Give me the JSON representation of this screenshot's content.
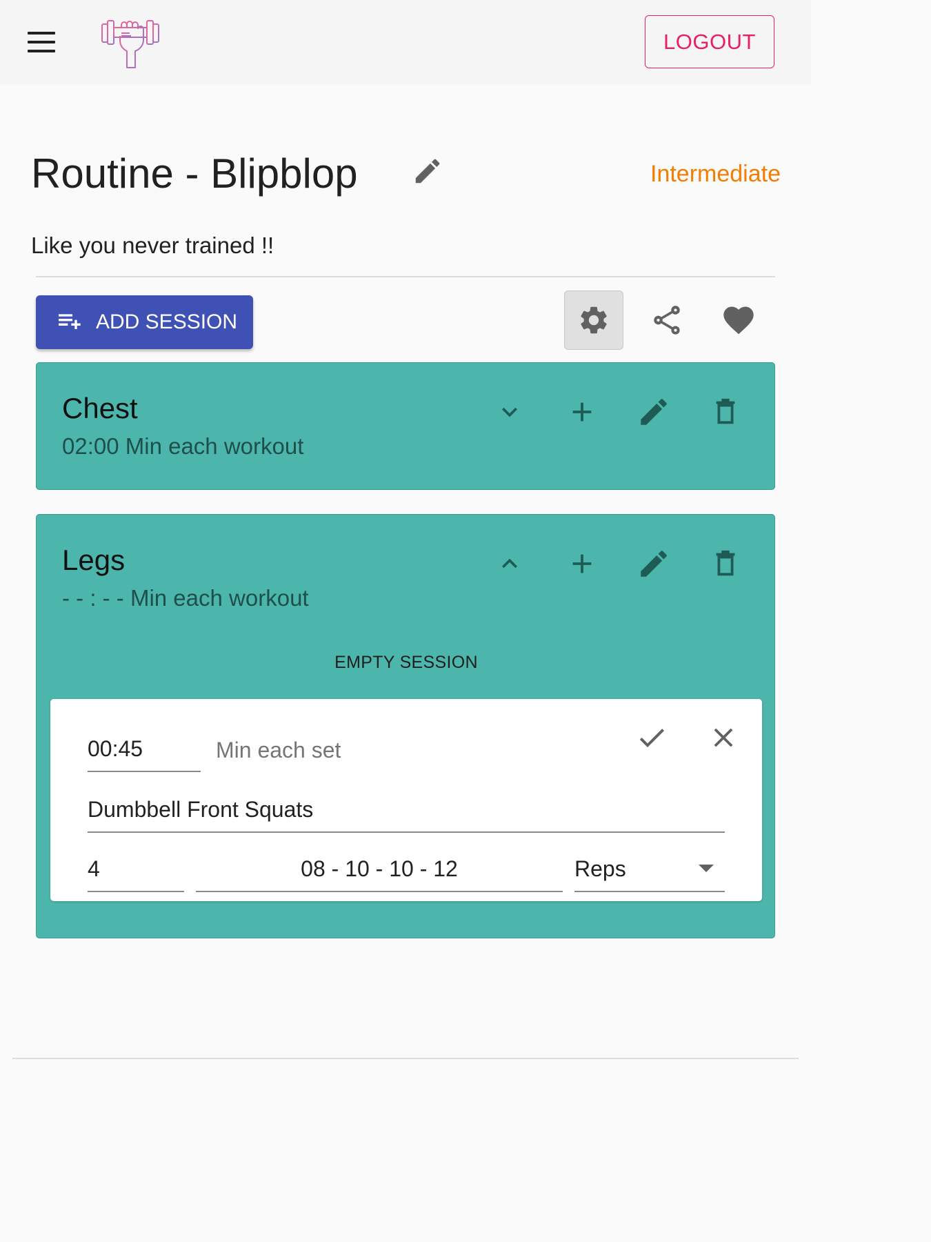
{
  "appbar": {
    "logout_label": "LOGOUT",
    "menu_icon": "hamburger-menu-icon",
    "logo_icon": "dumbbell-fist-logo"
  },
  "routine": {
    "title": "Routine - Blipblop",
    "level": "Intermediate",
    "description": "Like you never trained !!"
  },
  "toolbar": {
    "add_session_label": "ADD SESSION",
    "add_session_icon": "playlist-add-icon",
    "settings_icon": "gear-icon",
    "share_icon": "share-icon",
    "favorite_icon": "heart-icon"
  },
  "sessions": [
    {
      "name": "Chest",
      "subtitle": "02:00 Min each workout",
      "expanded": false
    },
    {
      "name": "Legs",
      "subtitle": "- - : - - Min each workout",
      "expanded": true,
      "empty_label": "EMPTY SESSION",
      "form": {
        "time_value": "00:45",
        "time_label": "Min each set",
        "exercise_name": "Dumbbell Front Squats",
        "sets": "4",
        "reps": "08 - 10 - 10 - 12",
        "unit": "Reps"
      }
    }
  ],
  "colors": {
    "accent": "#e91e63",
    "primary": "#3f51b5",
    "level": "#f57c00",
    "card": "#4db6ac"
  }
}
